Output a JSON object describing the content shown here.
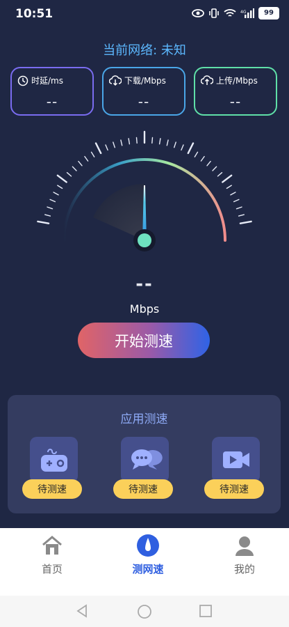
{
  "status": {
    "time": "10:51",
    "battery": "99"
  },
  "network": {
    "title": "当前网络: 未知"
  },
  "metrics": [
    {
      "label": "时延/ms",
      "value": "--",
      "color": "#7a6cf0"
    },
    {
      "label": "下载/Mbps",
      "value": "--",
      "color": "#4aa6e8"
    },
    {
      "label": "上传/Mbps",
      "value": "--",
      "color": "#5fe0a8"
    }
  ],
  "speed": {
    "value": "--",
    "unit": "Mbps"
  },
  "start_button": {
    "label": "开始测速"
  },
  "app_test": {
    "title": "应用测速",
    "items": [
      {
        "icon": "game-controller-icon",
        "status": "待测速"
      },
      {
        "icon": "chat-bubbles-icon",
        "status": "待测速"
      },
      {
        "icon": "video-camera-icon",
        "status": "待测速"
      }
    ]
  },
  "nav": {
    "items": [
      {
        "label": "首页",
        "icon": "home-icon",
        "active": false
      },
      {
        "label": "测网速",
        "icon": "speed-drop-icon",
        "active": true
      },
      {
        "label": "我的",
        "icon": "user-icon",
        "active": false
      }
    ],
    "active_color": "#2f5fe0",
    "inactive_color": "#666666"
  }
}
